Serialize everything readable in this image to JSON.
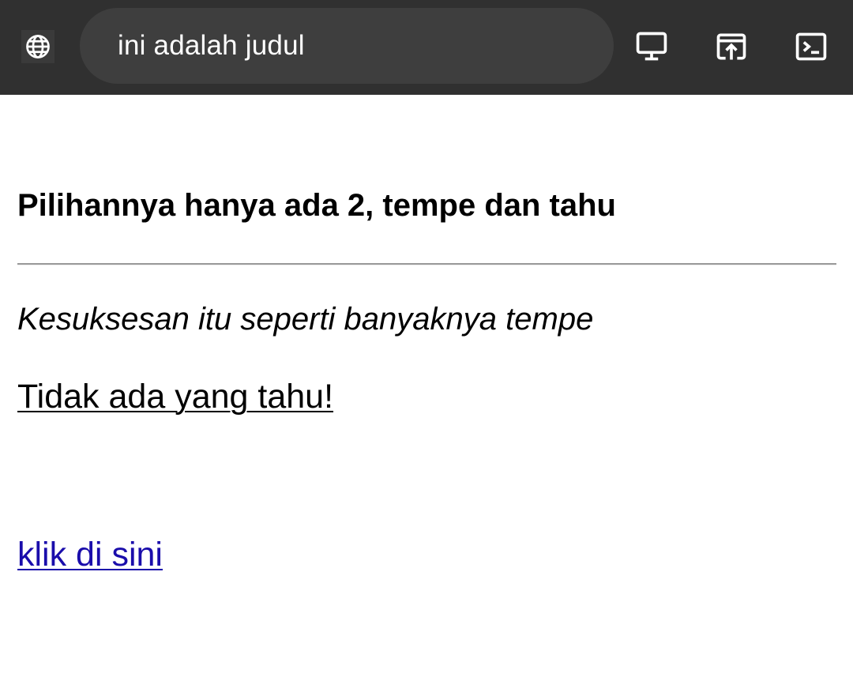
{
  "browser": {
    "url_title": "ini adalah judul",
    "icons": [
      "globe-icon",
      "desktop-icon",
      "open-in-browser-icon",
      "terminal-icon"
    ]
  },
  "page": {
    "heading": "Pilihannya hanya ada 2, tempe dan tahu",
    "italic_text": "Kesuksesan itu seperti banyaknya tempe",
    "underlined_text": "Tidak ada yang tahu!",
    "link_text": "klik di sini",
    "link_color": "#1a0dab"
  },
  "colors": {
    "topbar": "#303030",
    "url_box": "#3e3e3e",
    "icon": "#ffffff"
  }
}
